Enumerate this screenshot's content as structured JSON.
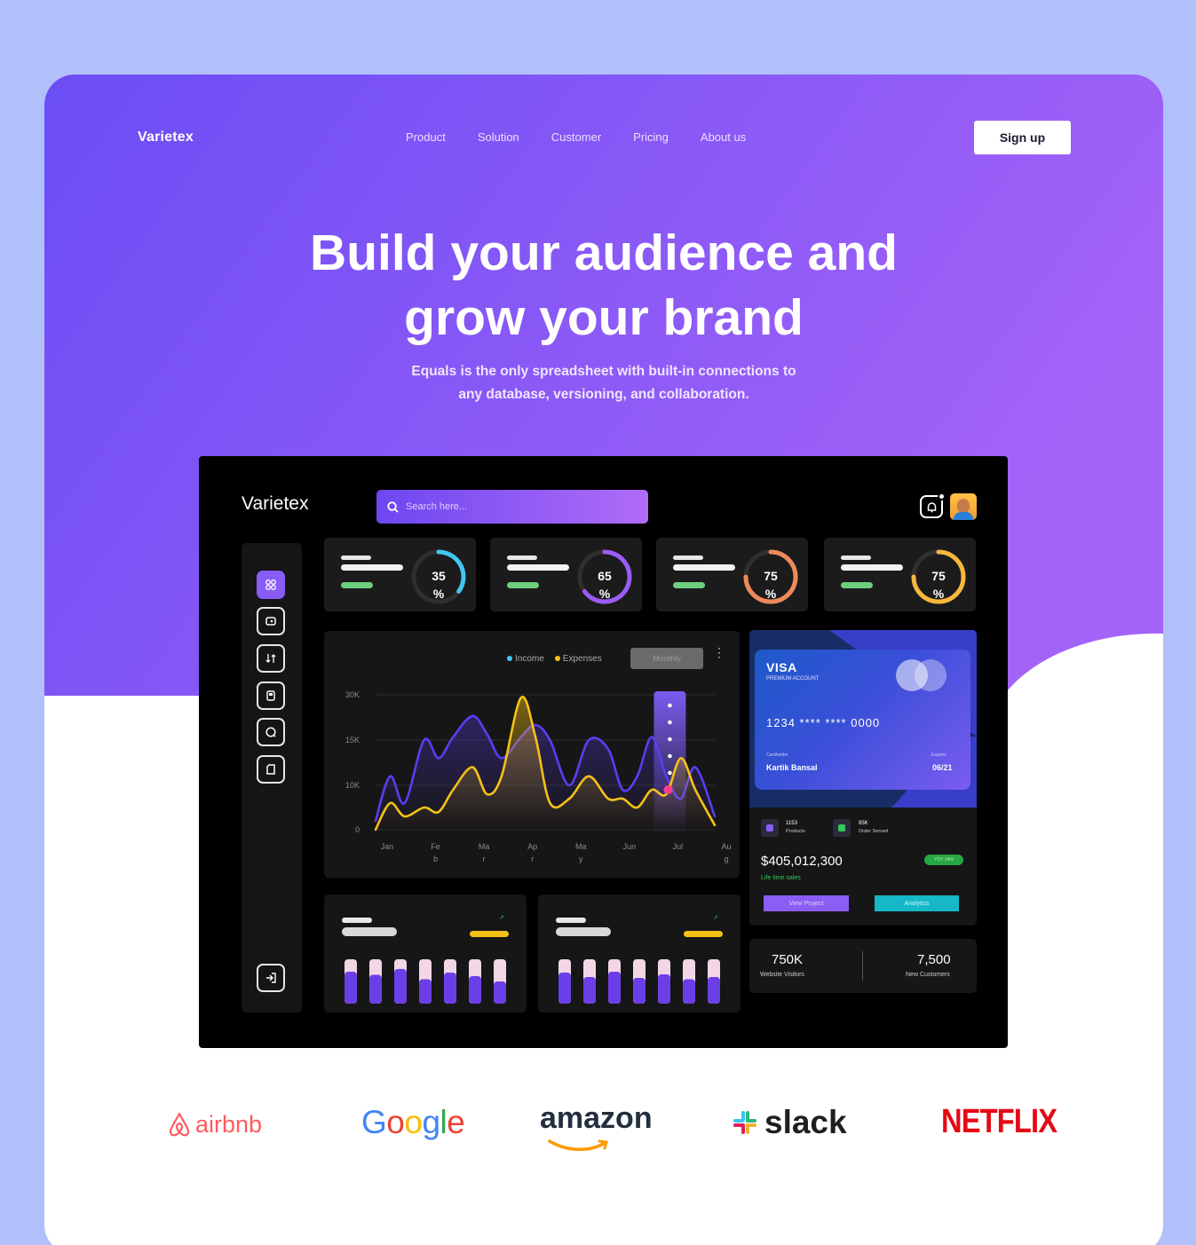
{
  "nav": {
    "logo": "Varietex",
    "links": [
      "Product",
      "Solution",
      "Customer",
      "Pricing",
      "About us"
    ],
    "signup_label": "Sign up"
  },
  "hero": {
    "headline_line1": "Build your audience and",
    "headline_line2": "grow your brand",
    "sub_line1": "Equals is the only spreadsheet with built-in connections to",
    "sub_line2": "any database, versioning, and collaboration."
  },
  "dashboard": {
    "logo": "Varietex",
    "search_placeholder": "Search here...",
    "stats": [
      {
        "value": 35,
        "label": "35",
        "unit": "%",
        "color": "#3ec7f0"
      },
      {
        "value": 65,
        "label": "65",
        "unit": "%",
        "color": "#9b5cf6"
      },
      {
        "value": 75,
        "label": "75",
        "unit": "%",
        "color": "#f0895a"
      },
      {
        "value": 75,
        "label": "75",
        "unit": "%",
        "color": "#f5b73c"
      }
    ],
    "legend": {
      "income": "Income",
      "expenses": "Expenses",
      "income_color": "#3ec7f0",
      "expenses_color": "#f5c117"
    },
    "monthly_label": "Monthly",
    "card": {
      "brand": "VISA",
      "type": "PREMIUM ACCOUNT",
      "number": "1234   ****   ****   0000",
      "holder_label": "Cardholder",
      "holder": "Kartik Bansal",
      "expiry_label": "Expires",
      "expiry": "06/21",
      "products_value": "1153",
      "products_label": "Products",
      "orders_value": "85K",
      "orders_label": "Order Served",
      "amount": "$405,012,300",
      "amount_label": "Life time sales",
      "badge": "YOY 34%",
      "view_label": "View Project",
      "analytics_label": "Analytics"
    },
    "visitors": {
      "value": "750K",
      "label": "Website Visitors"
    },
    "customers": {
      "value": "7,500",
      "label": "New Customers"
    },
    "bar_groups": [
      [
        0.72,
        0.65,
        0.78,
        0.55,
        0.7,
        0.62,
        0.5
      ],
      [
        0.7,
        0.6,
        0.72,
        0.58,
        0.66,
        0.55,
        0.6
      ]
    ]
  },
  "brands": {
    "airbnb": "airbnb",
    "google": [
      "G",
      "o",
      "o",
      "g",
      "l",
      "e"
    ],
    "google_colors": [
      "#4285f4",
      "#ea4335",
      "#fbbc05",
      "#4285f4",
      "#34a853",
      "#ea4335"
    ],
    "amazon": "amazon",
    "slack": "slack",
    "netflix": "NETFLIX"
  },
  "chart_data": {
    "type": "area",
    "categories": [
      "Jan",
      "Feb",
      "Mar",
      "Apr",
      "May",
      "Jun",
      "Jul",
      "Aug"
    ],
    "xtick_labels": [
      [
        "Jan"
      ],
      [
        "Fe",
        "b"
      ],
      [
        "Ma",
        "r"
      ],
      [
        "Ap",
        "r"
      ],
      [
        "Ma",
        "y"
      ],
      [
        "Jun"
      ],
      [
        "Jul"
      ],
      [
        "Au",
        "g"
      ]
    ],
    "yticks": [
      "0",
      "10K",
      "15K",
      "30K"
    ],
    "series": [
      {
        "name": "Income",
        "color": "#5b3df0",
        "x": [
          0,
          0.3,
          0.6,
          1.0,
          1.3,
          1.6,
          2.0,
          2.3,
          2.6,
          3.0,
          3.3,
          3.6,
          4.0,
          4.4,
          4.8,
          5.1,
          5.4,
          5.7,
          6.0,
          6.3,
          6.6,
          7.0
        ],
        "y": [
          2000,
          11000,
          6000,
          15000,
          13000,
          16000,
          23000,
          17000,
          13000,
          16000,
          20000,
          15000,
          10000,
          15000,
          14000,
          9000,
          11000,
          16000,
          11000,
          7000,
          12000,
          3000
        ]
      },
      {
        "name": "Expenses",
        "color": "#f5c117",
        "x": [
          0,
          0.3,
          0.6,
          1.0,
          1.3,
          1.6,
          2.0,
          2.3,
          2.6,
          3.0,
          3.3,
          3.6,
          4.0,
          4.4,
          4.8,
          5.1,
          5.4,
          5.7,
          6.0,
          6.3,
          6.6,
          7.0
        ],
        "y": [
          0,
          6000,
          3000,
          5000,
          4000,
          9000,
          12000,
          8000,
          11000,
          29000,
          16000,
          6000,
          7000,
          11000,
          7000,
          7000,
          5000,
          9000,
          8000,
          13000,
          9000,
          1000
        ]
      }
    ],
    "ylim": [
      0,
      30000
    ],
    "highlight_category": "Jul"
  }
}
